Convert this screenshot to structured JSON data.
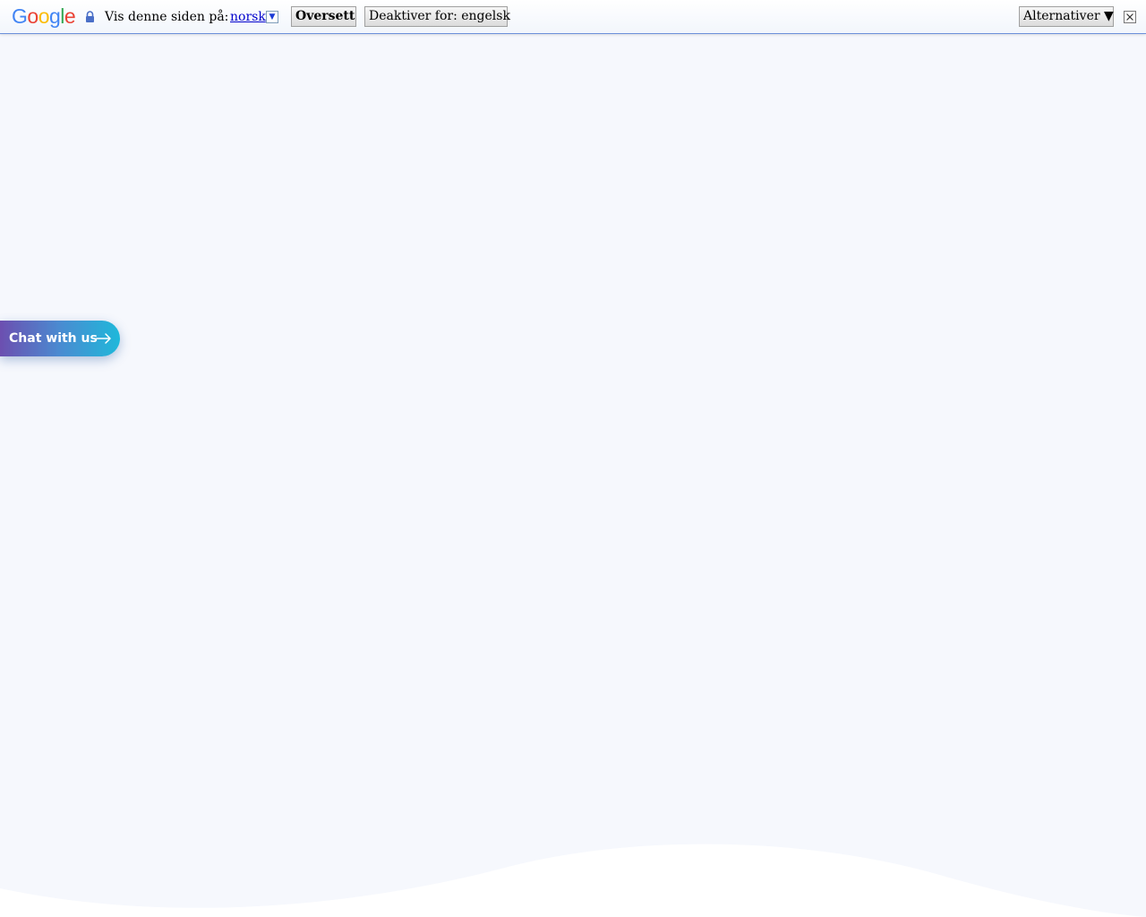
{
  "translate_bar": {
    "logo_letters": [
      "G",
      "o",
      "o",
      "g",
      "l",
      "e"
    ],
    "prompt": "Vis denne siden på:",
    "language_link": "norsk",
    "translate_button": "Oversett",
    "disable_button": "Deaktiver for: engelsk",
    "options_button": "Alternativer ▼",
    "icons": [
      "lock-icon",
      "dropdown-arrow-icon",
      "close-icon"
    ]
  },
  "chat_widget": {
    "label": "Chat with us",
    "icon": "arrow-right-icon",
    "gradient": [
      "#6c4fb0",
      "#4a8bd1",
      "#1fb8da"
    ]
  },
  "colors": {
    "page_background": "#f6f8fd",
    "bar_border": "#6b90da",
    "link": "#0000cc"
  }
}
